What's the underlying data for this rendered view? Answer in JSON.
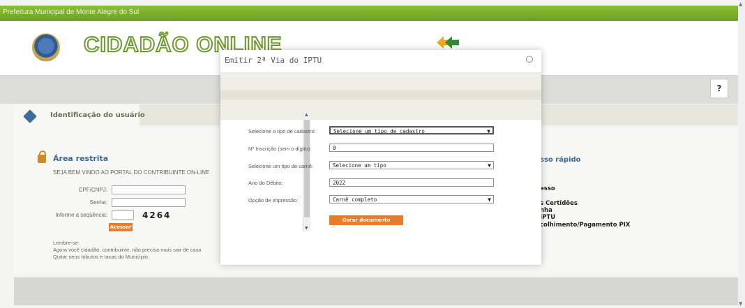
{
  "topbar": {
    "title": "Prefeitura Municipal de Monte Alegre do Sul"
  },
  "header": {
    "logo_text": "CIDADÃO ONLINE"
  },
  "help": {
    "label": "?"
  },
  "identification": {
    "title": "Identificação do usuário"
  },
  "restricted": {
    "title": "Área restrita",
    "welcome": "SEJA BEM VINDO AO PORTAL DO CONTRIBUINTE ON-LINE",
    "cpf_label": "CPF/CNPJ:",
    "senha_label": "Senha:",
    "sequencia_label": "Informe a seqüência:",
    "captcha": "4264",
    "acessar_button": "Acessar",
    "lembre_title": "Lembre-se:",
    "lembre_line1": "Agora você cidadão, contribuinte, não precisa mais sair de casa",
    "lembre_line2": "Quitar seus tributos e taxas do Município."
  },
  "quick_access": {
    "title_partial": "sso rápido",
    "links": [
      "esso",
      "s Certidões",
      "nha",
      "IPTU",
      "colhimento/Pagamento PIX"
    ]
  },
  "modal": {
    "title": "Emitir 2ª Via do IPTU",
    "fields": {
      "tipo_cadastro_label": "Selecione o tipo de cadastro:",
      "tipo_cadastro_value": "Selecione um tipo de cadastro",
      "inscricao_label": "Nº Inscrição (sem o dígito):",
      "inscricao_value": "0",
      "tipo_carne_label": "Selecione um tipo de carnê:",
      "tipo_carne_value": "Selecione um tipo",
      "ano_label": "Ano do Débito:",
      "ano_value": "2022",
      "opcao_label": "Opção de impressão:",
      "opcao_value": "Carnê completo"
    },
    "submit_button": "Gerar documento"
  },
  "colors": {
    "topbar_green": "#7aab2b",
    "logo_green": "#6f9a2e",
    "button_orange": "#e87e2b",
    "title_blue": "#3b6a93"
  },
  "icons": [
    "crest-icon",
    "arrow-logo-icon",
    "identification-icon",
    "lock-icon",
    "close-icon",
    "chevron-down-icon"
  ]
}
